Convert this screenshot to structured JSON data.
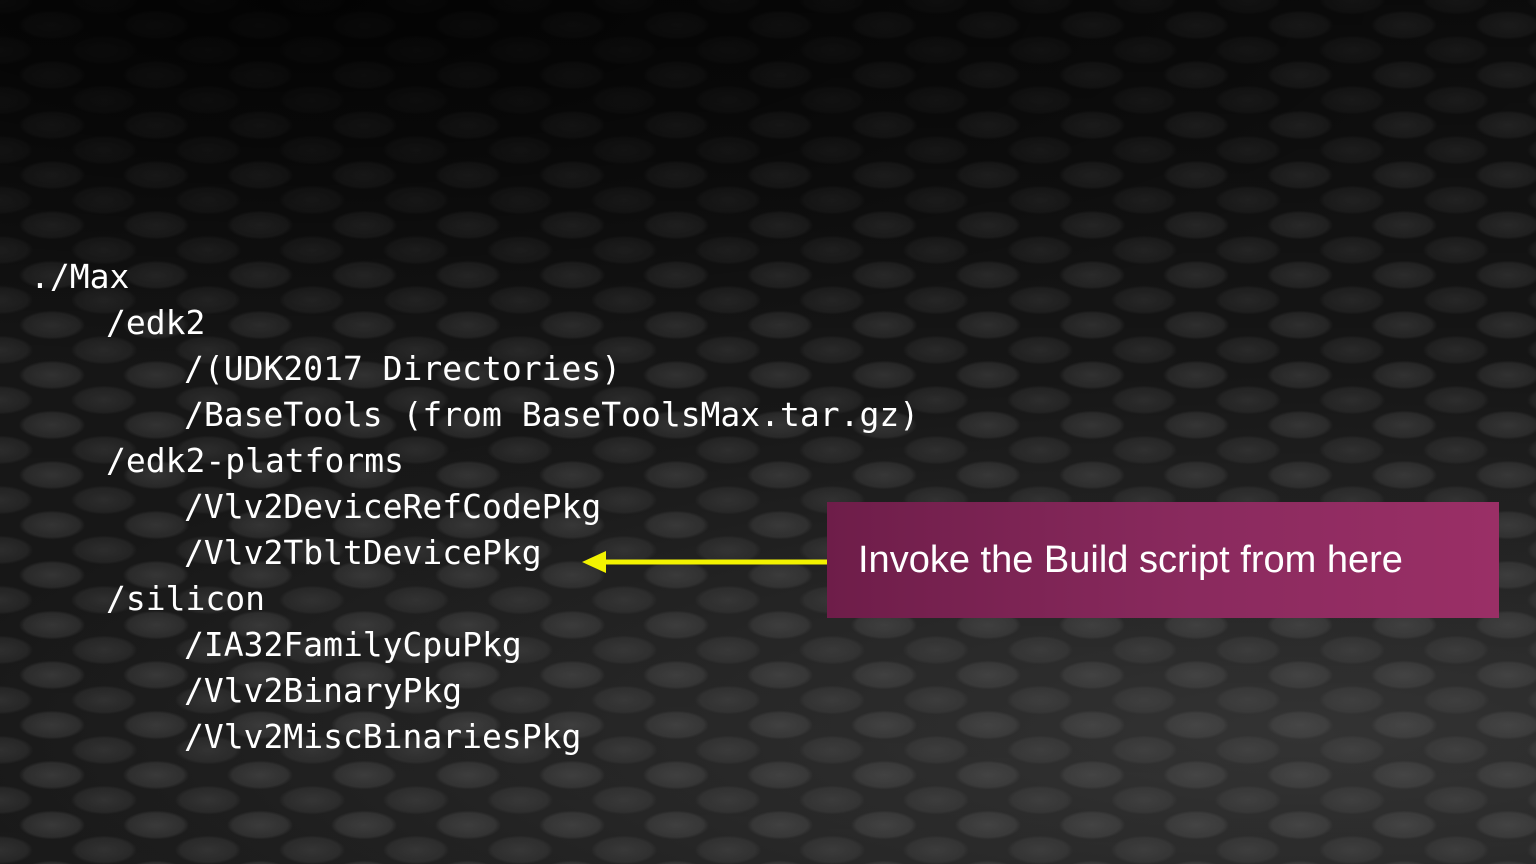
{
  "directory_tree": [
    {
      "text": "./Max",
      "level": 0
    },
    {
      "text": "/edk2",
      "level": 1
    },
    {
      "text": "/(UDK2017 Directories)",
      "level": 2
    },
    {
      "text": "/BaseTools (from BaseToolsMax.tar.gz)",
      "level": 2
    },
    {
      "text": "/edk2-platforms",
      "level": 1
    },
    {
      "text": "/Vlv2DeviceRefCodePkg",
      "level": 2
    },
    {
      "text": "/Vlv2TbltDevicePkg",
      "level": 2
    },
    {
      "text": "/silicon",
      "level": 1
    },
    {
      "text": "/IA32FamilyCpuPkg",
      "level": 2
    },
    {
      "text": "/Vlv2BinaryPkg",
      "level": 2
    },
    {
      "text": "/Vlv2MiscBinariesPkg",
      "level": 2
    }
  ],
  "callout": {
    "text": "Invoke the Build script from here",
    "background_color": "#8a2a5e",
    "arrow_color": "#f2f200",
    "arrow_icon": "arrow-left-icon"
  }
}
